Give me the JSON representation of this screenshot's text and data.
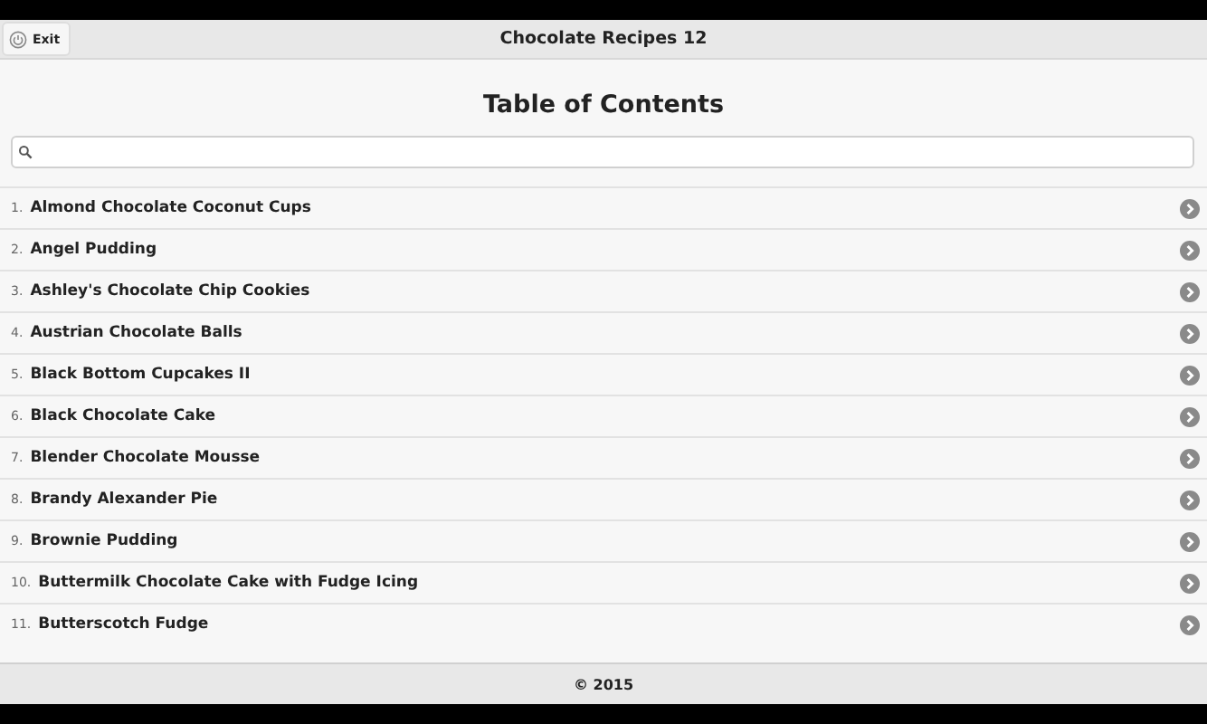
{
  "header": {
    "exit_button": "Exit",
    "title": "Chocolate Recipes 12"
  },
  "heading": "Table of Contents",
  "items": [
    {
      "number": "1.",
      "title": "Almond Chocolate Coconut Cups"
    },
    {
      "number": "2.",
      "title": "Angel Pudding"
    },
    {
      "number": "3.",
      "title": "Ashley's Chocolate Chip Cookies"
    },
    {
      "number": "4.",
      "title": "Austrian Chocolate Balls"
    },
    {
      "number": "5.",
      "title": "Black Bottom Cupcakes II"
    },
    {
      "number": "6.",
      "title": "Black Chocolate Cake"
    },
    {
      "number": "7.",
      "title": "Blender Chocolate Mousse"
    },
    {
      "number": "8.",
      "title": "Brandy Alexander Pie"
    },
    {
      "number": "9.",
      "title": "Brownie Pudding"
    },
    {
      "number": "10.",
      "title": "Buttermilk Chocolate Cake with Fudge Icing"
    },
    {
      "number": "11.",
      "title": "Butterscotch Fudge"
    }
  ],
  "footer": "© 2015"
}
